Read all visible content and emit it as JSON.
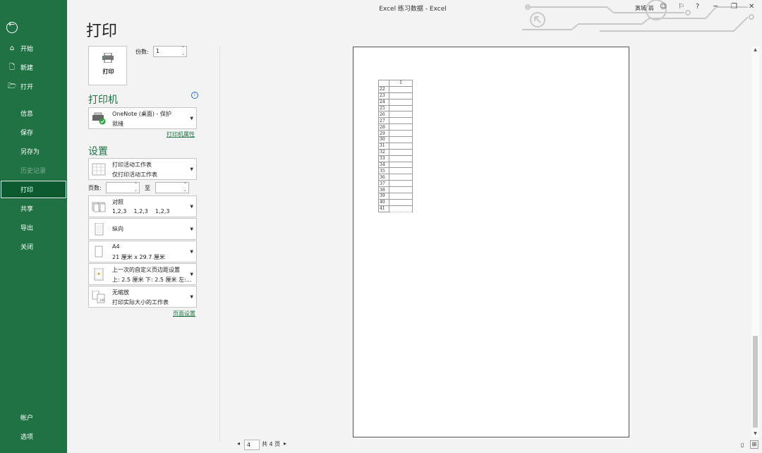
{
  "window": {
    "title": "Excel 练习数据  -  Excel",
    "user": "寅城 翁",
    "help": "?",
    "minimize": "─",
    "restore": "❐",
    "close": "✕"
  },
  "sidebar": {
    "items": [
      {
        "label": "开始",
        "icon": "home-icon"
      },
      {
        "label": "新建",
        "icon": "new-file-icon"
      },
      {
        "label": "打开",
        "icon": "folder-open-icon"
      },
      {
        "label": "信息"
      },
      {
        "label": "保存"
      },
      {
        "label": "另存为"
      },
      {
        "label": "历史记录"
      },
      {
        "label": "打印"
      },
      {
        "label": "共享"
      },
      {
        "label": "导出"
      },
      {
        "label": "关闭"
      },
      {
        "label": "帐户"
      },
      {
        "label": "选项"
      }
    ],
    "selected": "打印",
    "accent": "#207245"
  },
  "heading": "打印",
  "print_button": {
    "label": "打印"
  },
  "copies": {
    "label": "份数:",
    "value": "1"
  },
  "printer": {
    "title": "打印机",
    "name": "OneNote (桌面) - 保护",
    "status": "就绪",
    "properties_link": "打印机属性"
  },
  "settings": {
    "title": "设置",
    "print_what": {
      "line1": "打印活动工作表",
      "line2": "仅打印活动工作表"
    },
    "pages_label": "页数:",
    "to_label": "至",
    "collate": {
      "line1": "对照",
      "line2": "1,2,3    1,2,3    1,2,3"
    },
    "orientation": {
      "line1": "纵向"
    },
    "paper": {
      "line1": "A4",
      "line2": "21 厘米 x 29.7 厘米"
    },
    "margins": {
      "line1": "上一次的自定义页边距设置",
      "line2": "上: 2.5 厘米 下: 2.5 厘米 左:..."
    },
    "scaling": {
      "line1": "无缩放",
      "line2": "打印实际大小的工作表"
    },
    "page_setup_link": "页面设置"
  },
  "preview": {
    "column_header": "I",
    "row_numbers": [
      "22",
      "23",
      "24",
      "25",
      "26",
      "27",
      "28",
      "29",
      "30",
      "31",
      "32",
      "33",
      "34",
      "35",
      "36",
      "37",
      "38",
      "39",
      "40",
      "41"
    ]
  },
  "pagination": {
    "current": "4",
    "total_label": "共 4 页"
  }
}
